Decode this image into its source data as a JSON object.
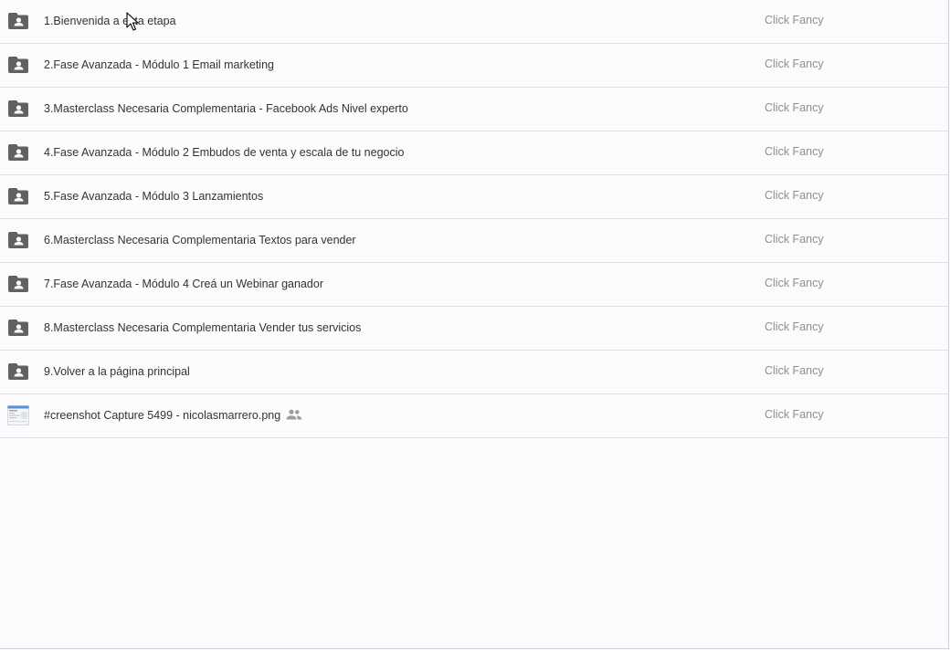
{
  "colors": {
    "folder_icon": "#616161",
    "owner_text": "#8f8f8f",
    "name_text": "#333333",
    "divider": "#e0e0e0"
  },
  "rows": [
    {
      "name": "1.Bienvenida a esta etapa",
      "owner": "Click Fancy",
      "icon": "shared-folder-icon"
    },
    {
      "name": "2.Fase Avanzada - Módulo 1  Email marketing",
      "owner": "Click Fancy",
      "icon": "shared-folder-icon"
    },
    {
      "name": "3.Masterclass Necesaria Complementaria - Facebook Ads Nivel experto",
      "owner": "Click Fancy",
      "icon": "shared-folder-icon"
    },
    {
      "name": "4.Fase Avanzada - Módulo 2  Embudos de venta y escala de tu negocio",
      "owner": "Click Fancy",
      "icon": "shared-folder-icon"
    },
    {
      "name": "5.Fase Avanzada - Módulo 3  Lanzamientos",
      "owner": "Click Fancy",
      "icon": "shared-folder-icon"
    },
    {
      "name": "6.Masterclass Necesaria Complementaria  Textos para vender",
      "owner": "Click Fancy",
      "icon": "shared-folder-icon"
    },
    {
      "name": "7.Fase Avanzada - Módulo 4  Creá un Webinar ganador",
      "owner": "Click Fancy",
      "icon": "shared-folder-icon"
    },
    {
      "name": "8.Masterclass Necesaria Complementaria  Vender tus servicios",
      "owner": "Click Fancy",
      "icon": "shared-folder-icon"
    },
    {
      "name": "9.Volver a la página principal",
      "owner": "Click Fancy",
      "icon": "shared-folder-icon"
    },
    {
      "name": "#creenshot Capture 5499 - nicolasmarrero.png",
      "owner": "Click Fancy",
      "icon": "image-thumbnail-icon",
      "shared": true
    }
  ]
}
